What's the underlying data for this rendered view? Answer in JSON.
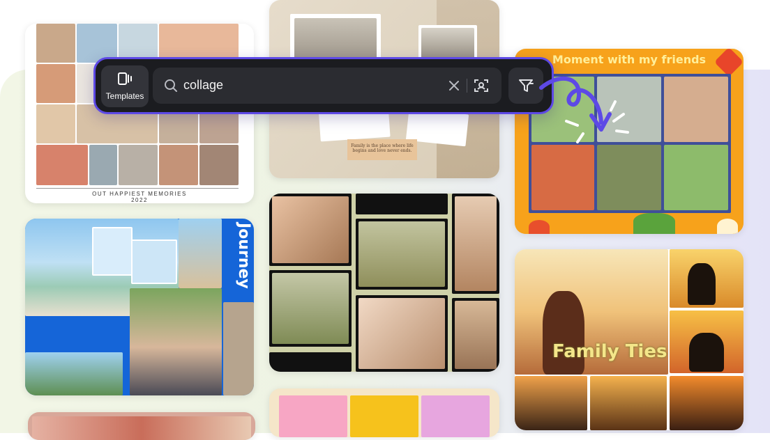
{
  "search": {
    "query": "collage",
    "mode_label": "Templates",
    "icons": {
      "mode": "video-template-icon",
      "search": "search-icon",
      "clear": "close-icon",
      "image_search": "scan-image-icon",
      "filter": "filter-icon"
    }
  },
  "templates": {
    "memories": {
      "caption_line1": "OUT HAPPIEST MEMORIES",
      "caption_line2": "2022"
    },
    "journey": {
      "title": "Journey"
    },
    "friends": {
      "title": "Moment with my friends"
    },
    "family": {
      "title": "Family Ties"
    },
    "vintage": {
      "note_line1": "Family is the place where life",
      "note_line2": "begins and love never ends."
    }
  },
  "colors": {
    "accent": "#5d49e6",
    "bar_bg": "#1b1c20",
    "friends_frame": "#f7a21b",
    "journey_blue": "#1565d8"
  }
}
